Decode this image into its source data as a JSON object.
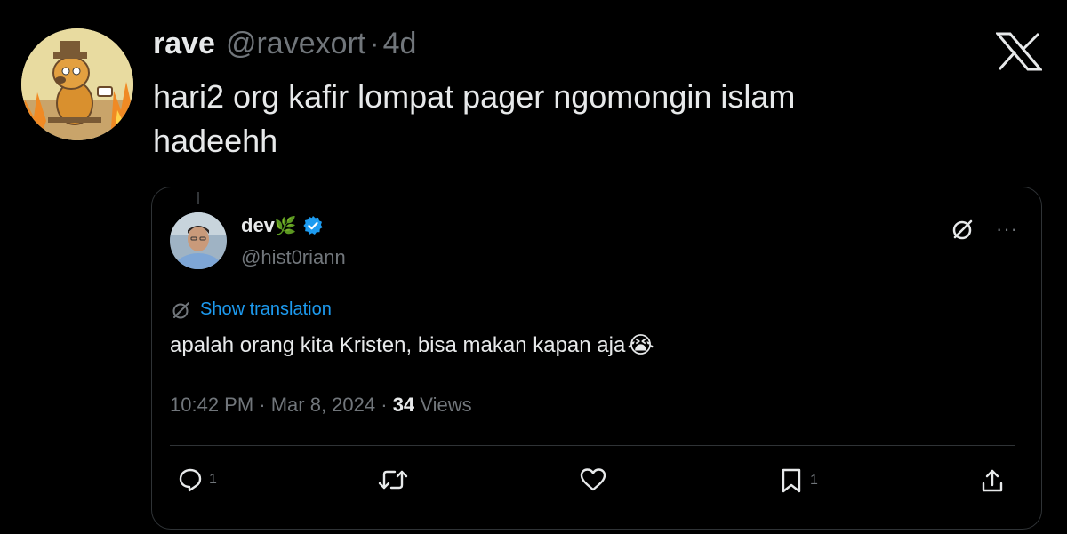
{
  "tweet": {
    "name": "rave",
    "handle": "@ravexort",
    "separator": "·",
    "time": "4d",
    "text_line1": "hari2 org kafir lompat pager ngomongin islam",
    "text_line2": "hadeehh"
  },
  "quote": {
    "name": "dev",
    "name_emoji": "🌿",
    "handle": "@hist0riann",
    "show_translation": "Show translation",
    "text": "apalah orang kita Kristen, bisa makan kapan aja",
    "emoji": "😭",
    "timestamp": "10:42 PM · Mar 8, 2024 ·",
    "views_count": "34",
    "views_label": "Views",
    "more": "···",
    "reply_count": "1",
    "bookmark_count": "1"
  },
  "icons": {
    "logo": "x-logo-icon",
    "verified": "verified-badge-icon",
    "grok": "grok-icon",
    "reply": "reply-icon",
    "retweet": "retweet-icon",
    "like": "heart-icon",
    "bookmark": "bookmark-icon",
    "share": "share-icon"
  },
  "colors": {
    "background": "#000000",
    "text": "#e7e9ea",
    "secondary": "#71767b",
    "accent": "#1d9bf0",
    "border": "#2f3336"
  }
}
